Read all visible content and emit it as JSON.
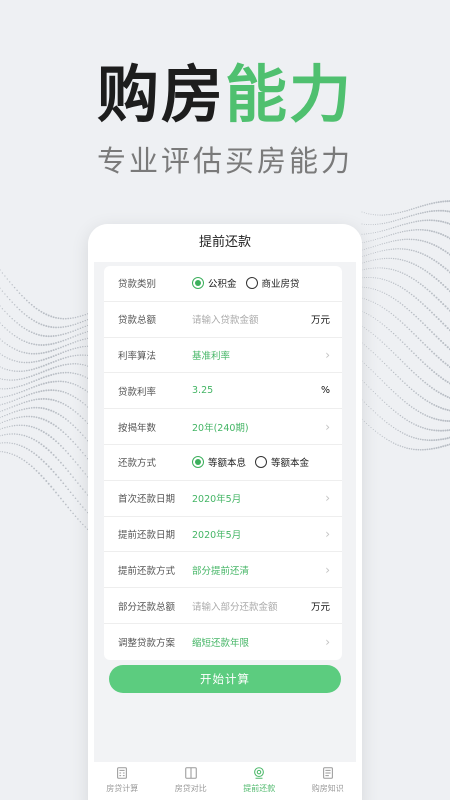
{
  "hero": {
    "title_dark": "购房",
    "title_green": "能力",
    "subtitle": "专业评估买房能力"
  },
  "screen": {
    "title": "提前还款"
  },
  "form": {
    "loan_type": {
      "label": "贷款类别",
      "options": [
        "公积金",
        "商业房贷"
      ],
      "selected": "公积金"
    },
    "loan_amount": {
      "label": "贷款总额",
      "placeholder": "请输入贷款金额",
      "unit": "万元"
    },
    "rate_method": {
      "label": "利率算法",
      "value": "基准利率"
    },
    "rate": {
      "label": "贷款利率",
      "value": "3.25",
      "unit": "%"
    },
    "years": {
      "label": "按揭年数",
      "value": "20年(240期)"
    },
    "repay_method": {
      "label": "还款方式",
      "options": [
        "等额本息",
        "等额本金"
      ],
      "selected": "等额本息"
    },
    "first_date": {
      "label": "首次还款日期",
      "value": "2020年5月"
    },
    "prepay_date": {
      "label": "提前还款日期",
      "value": "2020年5月"
    },
    "prepay_method": {
      "label": "提前还款方式",
      "value": "部分提前还清"
    },
    "partial_amount": {
      "label": "部分还款总额",
      "placeholder": "请输入部分还款金额",
      "unit": "万元"
    },
    "adjust_plan": {
      "label": "调整贷款方案",
      "value": "缩短还款年限"
    }
  },
  "button": {
    "calculate": "开始计算"
  },
  "tabs": [
    {
      "label": "房贷计算",
      "icon": "calculator-icon"
    },
    {
      "label": "房贷对比",
      "icon": "compare-icon"
    },
    {
      "label": "提前还款",
      "icon": "prepay-icon",
      "active": true
    },
    {
      "label": "购房知识",
      "icon": "book-icon"
    }
  ],
  "colors": {
    "accent": "#4fc06f",
    "button": "#5ccc7f"
  }
}
